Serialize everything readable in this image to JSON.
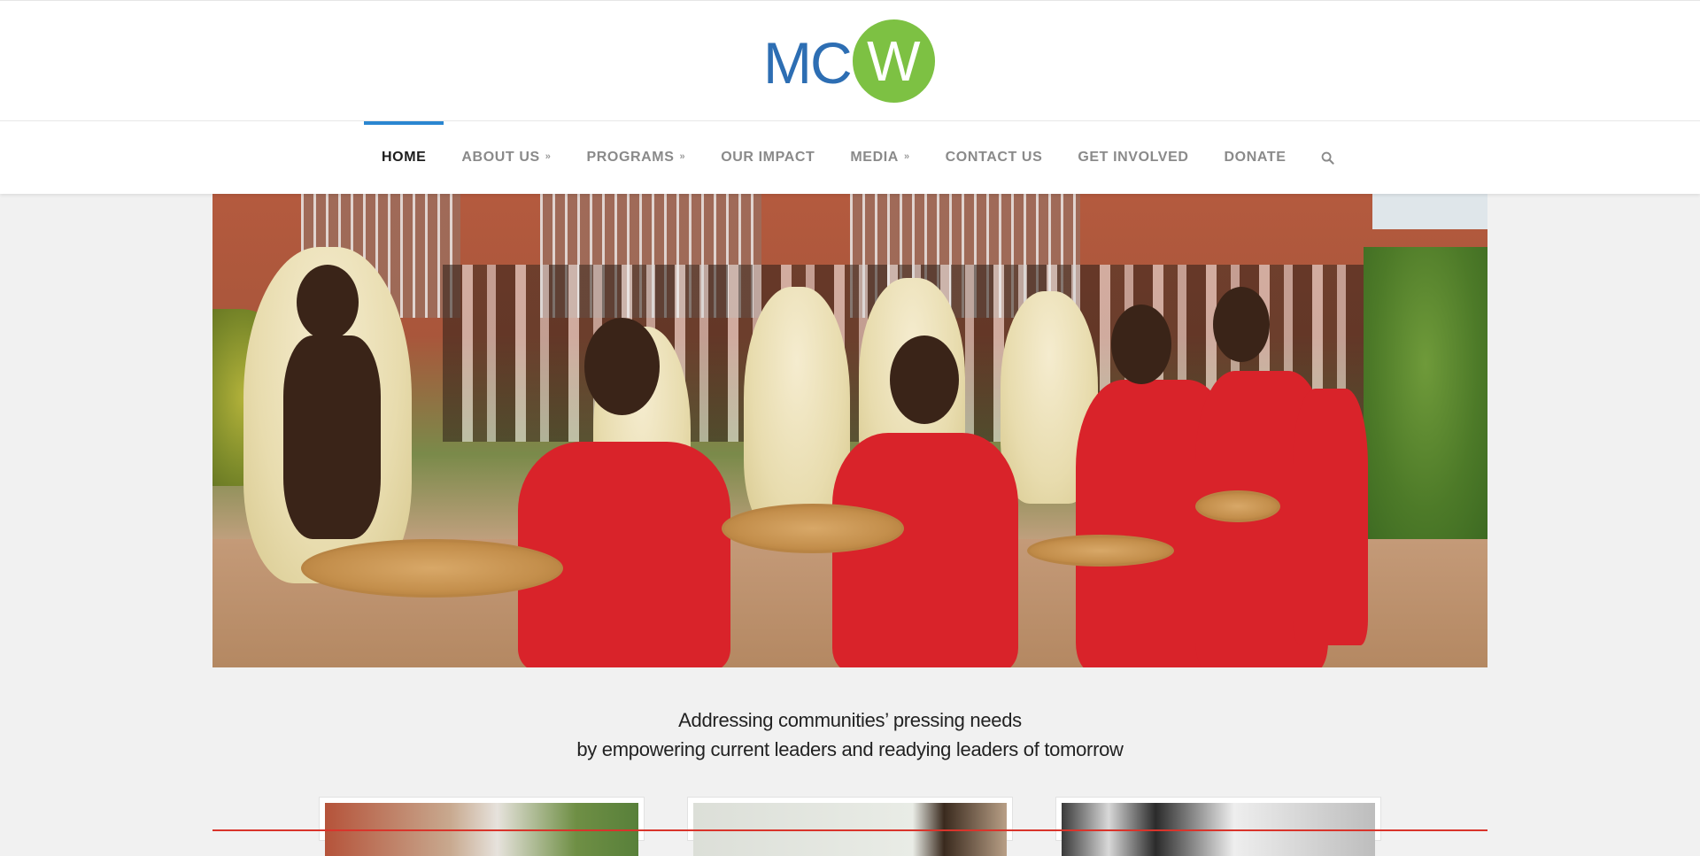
{
  "logo": {
    "text_mc": "MC",
    "text_w": "W",
    "mc_color": "#2d6eb3",
    "circle_color": "#7dc143"
  },
  "nav": {
    "items": [
      {
        "label": "HOME",
        "dropdown": false,
        "active": true
      },
      {
        "label": "ABOUT US",
        "dropdown": true,
        "active": false
      },
      {
        "label": "PROGRAMS",
        "dropdown": true,
        "active": false
      },
      {
        "label": "OUR IMPACT",
        "dropdown": false,
        "active": false
      },
      {
        "label": "MEDIA",
        "dropdown": true,
        "active": false
      },
      {
        "label": "CONTACT US",
        "dropdown": false,
        "active": false
      },
      {
        "label": "GET INVOLVED",
        "dropdown": false,
        "active": false
      },
      {
        "label": "DONATE",
        "dropdown": false,
        "active": false
      }
    ],
    "active_color": "#2a86d1",
    "search_icon": "search-icon"
  },
  "hero": {
    "image": "dancers-photo"
  },
  "tagline": {
    "line1": "Addressing communities’ pressing needs",
    "line2": "by empowering current leaders and readying leaders of tomorrow"
  },
  "cards": [
    {
      "image": "building-photo"
    },
    {
      "image": "room-photo"
    },
    {
      "image": "classroom-photo"
    }
  ]
}
